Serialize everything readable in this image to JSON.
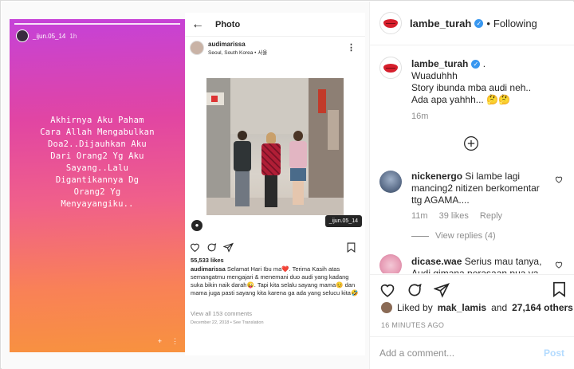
{
  "story": {
    "username": "_ijun.05_14",
    "time": "1h",
    "text": "Akhirnya Aku Paham\nCara Allah Mengabulkan\nDoa2..Dijauhkan Aku\nDari Orang2 Yg Aku\nSayang..Lalu\nDigantikannya Dg\nOrang2 Yg\nMenyayangiku..",
    "footer_icon_1": "+",
    "footer_icon_2": "⋮"
  },
  "phone": {
    "title": "Photo",
    "username": "audimarissa",
    "location": "Seoul, South Korea • 서울",
    "tag": "_ijun.05_14",
    "likes": "55,533 likes",
    "caption_user": "audimarissa",
    "caption_text": "Selamat Hari Ibu ma❤️. Terima Kasih atas semangatmu mengajari & menemani duo audi yang kadang suka bikin naik darah😜. Tapi kita selalu sayang mama😊 dan mama juga pasti sayang kita karena ga ada yang selucu kita🤣",
    "view_all": "View all 153 comments",
    "date": "December 22, 2018 • See Translation"
  },
  "post": {
    "username": "lambe_turah",
    "follow_label": "Following",
    "caption_user": "lambe_turah",
    "caption_lines": [
      "Wuaduhhh",
      "Story ibunda mba audi neh..",
      "Ada apa yahhh... 🤔🤔"
    ],
    "caption_time": "16m",
    "comments": [
      {
        "user": "nickenergo",
        "text": "Si lambe lagi mancing2 nitizen berkomentar ttg AGAMA....",
        "time": "11m",
        "likes": "39 likes",
        "reply": "Reply"
      },
      {
        "user": "dicase.wae",
        "text": "Serius mau tanya, Audi gimana perasaan pua ya"
      }
    ],
    "view_replies": "View replies (4)",
    "liked_prefix": "Liked by",
    "liked_user": "mak_lamis",
    "liked_and": "and",
    "liked_count": "27,164 others",
    "time_ago": "16 MINUTES AGO",
    "comment_placeholder": "Add a comment...",
    "post_label": "Post"
  },
  "colors": {
    "link_blue": "#3897f0",
    "post_disabled": "#b3dbff",
    "muted": "#8e8e8e"
  }
}
